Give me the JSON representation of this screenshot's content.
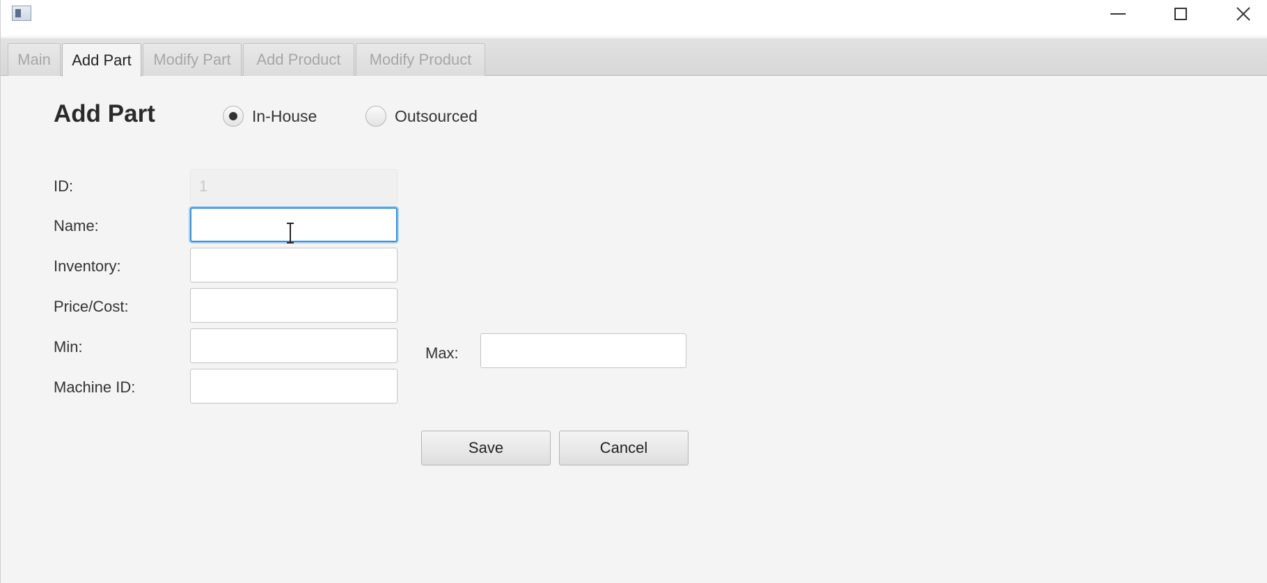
{
  "window": {
    "controls": {
      "minimize_icon": "minimize-icon",
      "maximize_icon": "maximize-icon",
      "close_icon": "close-icon"
    }
  },
  "tabs": [
    {
      "label": "Main",
      "active": false
    },
    {
      "label": "Add Part",
      "active": true
    },
    {
      "label": "Modify Part",
      "active": false
    },
    {
      "label": "Add Product",
      "active": false
    },
    {
      "label": "Modify Product",
      "active": false
    }
  ],
  "form": {
    "title": "Add Part",
    "source_options": [
      {
        "label": "In-House",
        "selected": true
      },
      {
        "label": "Outsourced",
        "selected": false
      }
    ],
    "fields": {
      "id": {
        "label": "ID:",
        "value": "1",
        "disabled": true
      },
      "name": {
        "label": "Name:",
        "value": "",
        "focused": true
      },
      "inventory": {
        "label": "Inventory:",
        "value": ""
      },
      "price": {
        "label": "Price/Cost:",
        "value": ""
      },
      "min": {
        "label": "Min:",
        "value": ""
      },
      "max": {
        "label": "Max:",
        "value": ""
      },
      "machine_id": {
        "label": "Machine ID:",
        "value": ""
      }
    },
    "buttons": {
      "save": "Save",
      "cancel": "Cancel"
    }
  },
  "colors": {
    "focus_ring": "#3a8fd6",
    "background": "#f4f4f4"
  }
}
